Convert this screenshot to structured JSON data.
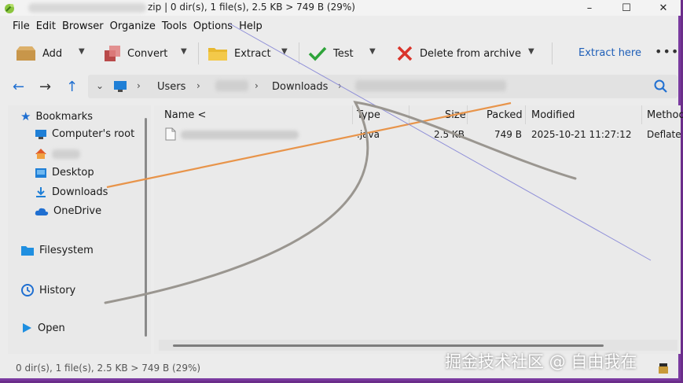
{
  "titlebar": {
    "text": "zip | 0 dir(s), 1 file(s), 2.5 KB > 749 B (29%)",
    "minimize": "–",
    "maximize": "☐",
    "close": "✕"
  },
  "menu": [
    "File",
    "Edit",
    "Browser",
    "Organize",
    "Tools",
    "Options",
    "Help"
  ],
  "toolbar": {
    "add_label": "Add",
    "convert_label": "Convert",
    "extract_label": "Extract",
    "test_label": "Test",
    "delete_label": "Delete from archive",
    "extract_here_label": "Extract here",
    "more_label": "•••"
  },
  "address": {
    "crumbs": [
      "Users",
      "Downloads"
    ]
  },
  "sidebar": {
    "bookmarks": "Bookmarks",
    "computer_root": "Computer's root",
    "desktop": "Desktop",
    "downloads": "Downloads",
    "onedrive": "OneDrive",
    "filesystem": "Filesystem",
    "history": "History",
    "open": "Open"
  },
  "columns": {
    "name": "Name <",
    "type": "Type",
    "size": "Size",
    "packed": "Packed",
    "modified": "Modified",
    "method": "Method"
  },
  "files": [
    {
      "type": ".java",
      "size": "2.5 KB",
      "packed": "749 B",
      "modified": "2025-10-21 11:27:12",
      "method": "Deflate"
    }
  ],
  "status": "0 dir(s), 1 file(s), 2.5 KB > 749 B (29%)",
  "watermark": "掘金技术社区 @ 自由我在",
  "colors": {
    "accent": "#1f6fd1",
    "link": "#1f5fb8",
    "frame": "#7a3aa0",
    "annotation_orange": "#e8944a",
    "annotation_gray": "#9a9690"
  }
}
